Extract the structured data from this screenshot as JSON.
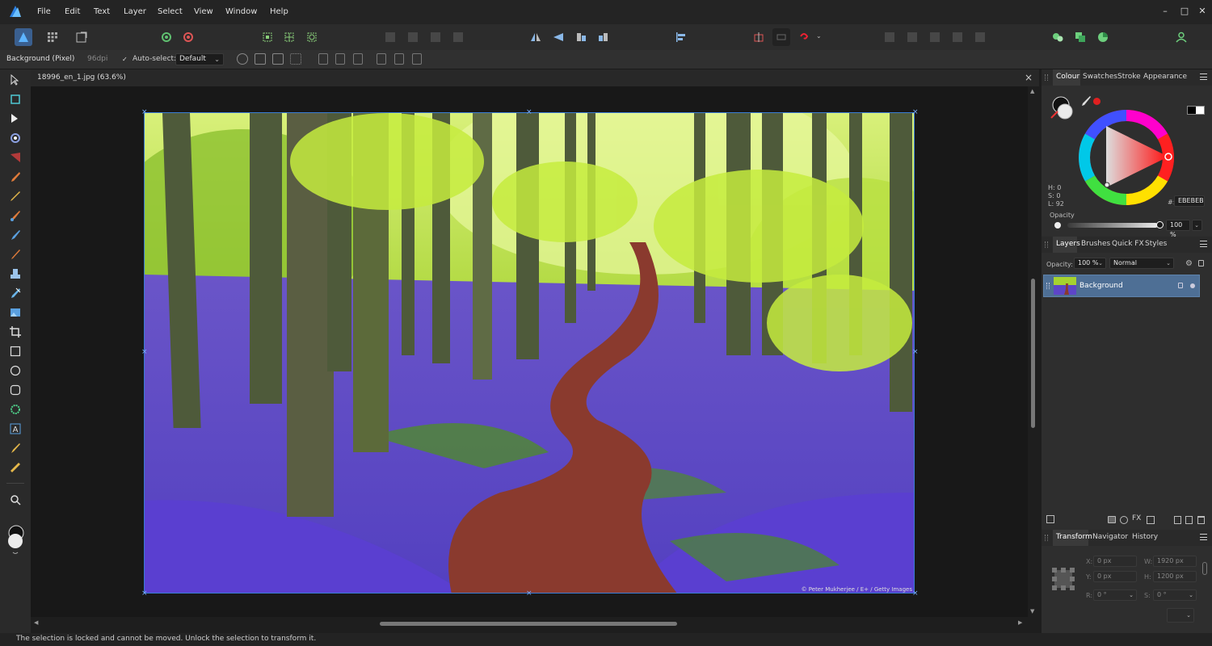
{
  "menubar": {
    "items": [
      "File",
      "Edit",
      "Text",
      "Layer",
      "Select",
      "View",
      "Window",
      "Help"
    ],
    "window_controls": [
      "–",
      "□",
      "✕"
    ]
  },
  "toolbar": {
    "persona_icons": [
      "designer-persona-icon",
      "pixel-persona-icon",
      "export-persona-icon"
    ],
    "groups": [
      "settings",
      "snapping",
      "transform",
      "arrange",
      "align",
      "boolean",
      "user"
    ]
  },
  "context": {
    "layer_label": "Background (Pixel)",
    "dpi": "96dpi",
    "auto_select_label": "Auto-select:",
    "auto_select_value": "Default"
  },
  "document": {
    "tab_title": "18996_en_1.jpg (63.6%)",
    "close": "×",
    "credit": "© Peter Mukherjee / E+ / Getty Images"
  },
  "status": {
    "text": "The selection is locked and cannot be moved. Unlock the selection to transform it."
  },
  "colour_panel": {
    "tabs": [
      "Colour",
      "Swatches",
      "Stroke",
      "Appearance"
    ],
    "h": "H: 0",
    "s": "S: 0",
    "l": "L: 92",
    "hex_label": "#:",
    "hex": "EBEBEB",
    "opacity_label": "Opacity",
    "opacity_value": "100 %",
    "colors": {
      "wheel_marker": "#ff0000",
      "fill": "#ebebeb",
      "accent": "#e03030"
    }
  },
  "layers_panel": {
    "tabs": [
      "Layers",
      "Brushes",
      "Quick FX",
      "Styles"
    ],
    "opacity_label": "Opacity:",
    "opacity_value": "100 %",
    "blend_mode": "Normal",
    "layer_name": "Background"
  },
  "transform_panel": {
    "tabs": [
      "Transform",
      "Navigator",
      "History"
    ],
    "x_label": "X:",
    "x_value": "0 px",
    "y_label": "Y:",
    "y_value": "0 px",
    "w_label": "W:",
    "w_value": "1920 px",
    "h_label": "H:",
    "h_value": "1200 px",
    "r_label": "R:",
    "r_value": "0 °",
    "s_label": "S:",
    "s_value": "0 °"
  }
}
